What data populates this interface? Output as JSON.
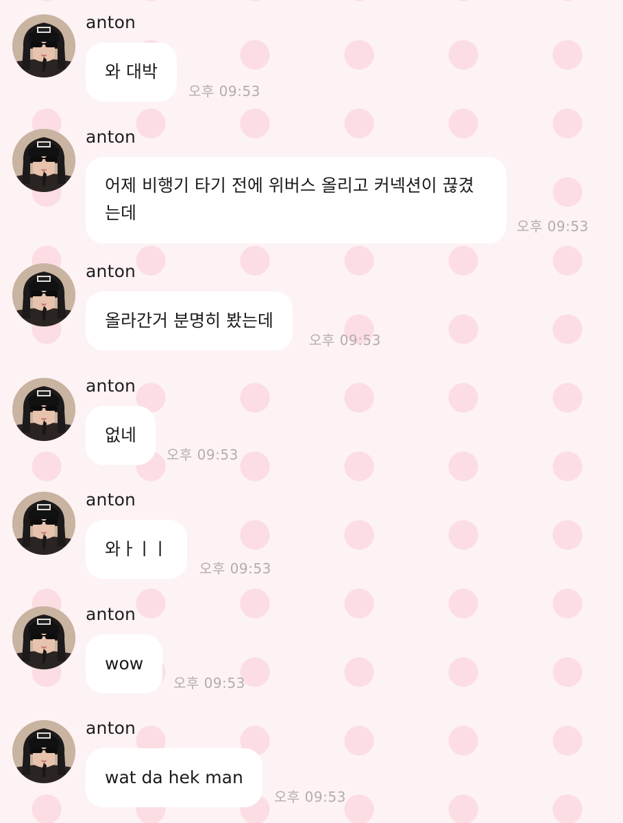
{
  "messages": [
    {
      "sender": "anton",
      "text": "와 대박",
      "time": "오후 09:53"
    },
    {
      "sender": "anton",
      "text": "어제 비행기 타기 전에 위버스 올리고 커넥션이 끊겼는데",
      "time": "오후 09:53"
    },
    {
      "sender": "anton",
      "text": "올라간거 분명히 봤는데",
      "time": "오후 09:53"
    },
    {
      "sender": "anton",
      "text": "없네",
      "time": "오후 09:53"
    },
    {
      "sender": "anton",
      "text": "와ㅏㅣㅣ",
      "time": "오후 09:53"
    },
    {
      "sender": "anton",
      "text": "wow",
      "time": "오후 09:53"
    },
    {
      "sender": "anton",
      "text": "wat da hek man",
      "time": "오후 09:53"
    }
  ],
  "colors": {
    "background": "#fdf2f4",
    "polka_dot": "#fbdde3",
    "bubble": "#ffffff",
    "time_text": "#b3adae"
  },
  "icons": {
    "avatar": "avatar-photo"
  }
}
